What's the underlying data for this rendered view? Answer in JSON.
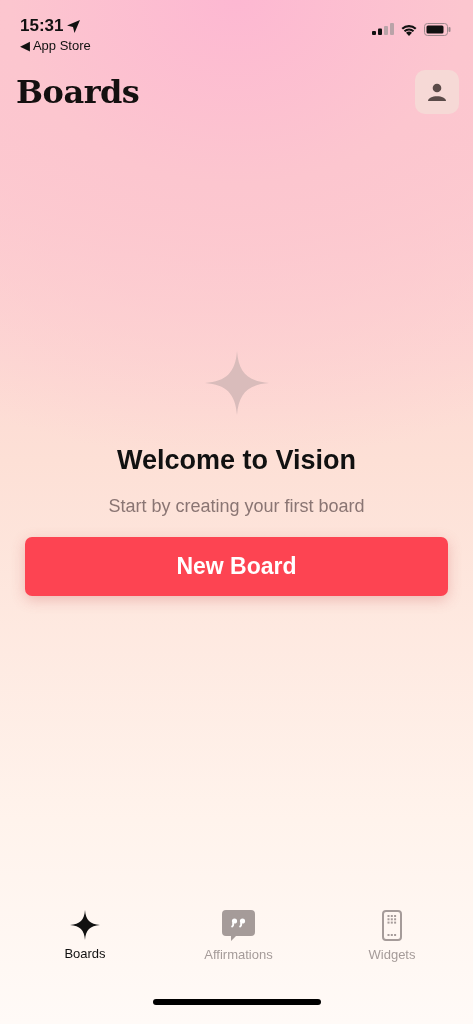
{
  "status_bar": {
    "time": "15:31",
    "back_link": "◀ App Store"
  },
  "header": {
    "title": "Boards"
  },
  "empty_state": {
    "heading": "Welcome to Vision",
    "subtitle": "Start by creating your first board",
    "button": "New Board"
  },
  "tab_bar": [
    {
      "label": "Boards",
      "kind": "sparkle",
      "selected": true
    },
    {
      "label": "Affirmations",
      "kind": "quote",
      "selected": false
    },
    {
      "label": "Widgets",
      "kind": "phone",
      "selected": false
    }
  ]
}
